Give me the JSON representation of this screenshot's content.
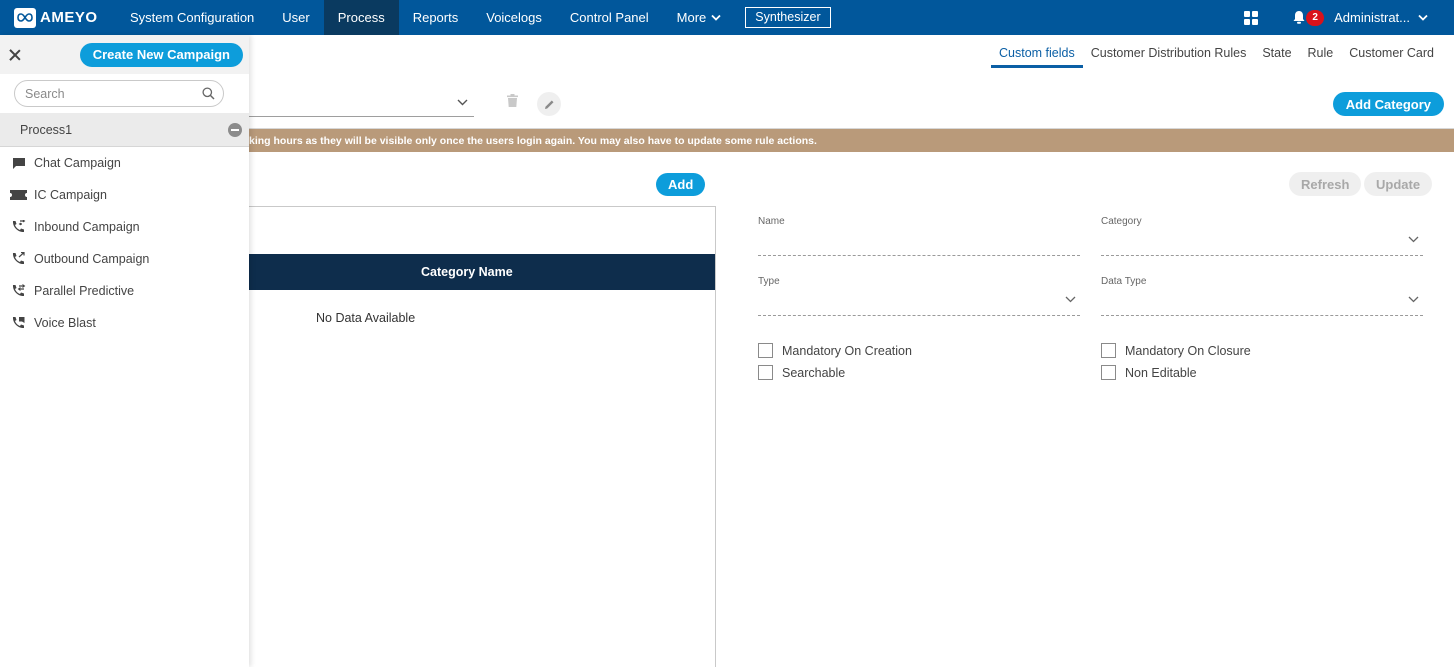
{
  "app": {
    "brand": "AMEYO",
    "colors": {
      "nav": "#01579b",
      "nav_active": "#0a3a60",
      "accent": "#0d9ddb",
      "banner": "#b99a7a",
      "table_header": "#0e2d4c",
      "badge": "#d9121b"
    }
  },
  "nav": {
    "items": [
      {
        "label": "System Configuration"
      },
      {
        "label": "User"
      },
      {
        "label": "Process",
        "active": true
      },
      {
        "label": "Reports"
      },
      {
        "label": "Voicelogs"
      },
      {
        "label": "Control Panel"
      },
      {
        "label": "More"
      }
    ],
    "synthesizer_label": "Synthesizer",
    "notification_count": "2",
    "user_label": "Administrat..."
  },
  "sidebar": {
    "create_label": "Create New Campaign",
    "search_placeholder": "Search",
    "process_name": "Process1",
    "campaigns": [
      {
        "label": "Chat Campaign",
        "icon": "chat-icon"
      },
      {
        "label": "IC Campaign",
        "icon": "ticket-icon"
      },
      {
        "label": "Inbound Campaign",
        "icon": "inbound-phone-icon"
      },
      {
        "label": "Outbound Campaign",
        "icon": "outbound-phone-icon"
      },
      {
        "label": "Parallel Predictive",
        "icon": "parallel-phone-icon"
      },
      {
        "label": "Voice Blast",
        "icon": "voice-blast-icon"
      }
    ]
  },
  "tabs": [
    {
      "label": "Custom fields",
      "active": true
    },
    {
      "label": "Customer Distribution Rules"
    },
    {
      "label": "State"
    },
    {
      "label": "Rule"
    },
    {
      "label": "Customer Card"
    }
  ],
  "main": {
    "add_category_label": "Add Category",
    "banner_text": "king hours as they will be visible only once the users login again. You may also have to update some rule actions.",
    "add_label": "Add",
    "table": {
      "columns": [
        "Category Name"
      ],
      "empty_text": "No Data Available"
    },
    "refresh_label": "Refresh",
    "update_label": "Update",
    "form": {
      "name_label": "Name",
      "category_label": "Category",
      "type_label": "Type",
      "data_type_label": "Data Type",
      "checkboxes": [
        {
          "label": "Mandatory On Creation",
          "checked": false
        },
        {
          "label": "Mandatory On Closure",
          "checked": false
        },
        {
          "label": "Searchable",
          "checked": false
        },
        {
          "label": "Non Editable",
          "checked": false
        }
      ]
    }
  }
}
